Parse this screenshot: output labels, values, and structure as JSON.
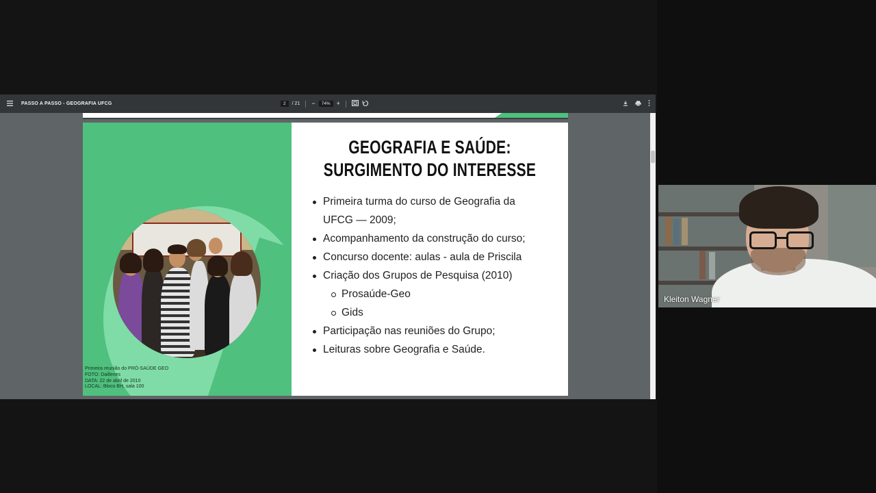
{
  "viewer": {
    "menu_icon": "hamburger-menu-icon",
    "doc_title": "PASSO A PASSO - GEOGRAFIA UFCG",
    "page_current": "2",
    "page_total": "/ 21",
    "zoom": "74%",
    "zoom_out": "−",
    "zoom_in": "+",
    "icons": [
      "fit-page-icon",
      "rotate-icon",
      "download-icon",
      "print-icon",
      "more-vert-icon"
    ]
  },
  "slide": {
    "title_line1": "GEOGRAFIA E SAÚDE:",
    "title_line2": "SURGIMENTO DO INTERESSE",
    "bullets": [
      {
        "text": "Primeira turma do curso de Geografia da",
        "level": 1
      },
      {
        "text": "UFCG — 2009;",
        "level": 0
      },
      {
        "text": "Acompanhamento da construção do curso;",
        "level": 1
      },
      {
        "text": "Concurso docente: aulas - aula de Priscila",
        "level": 1
      },
      {
        "text": "Criação dos Grupos de Pesquisa (2010)",
        "level": 1
      },
      {
        "text": "Prosaúde-Geo",
        "level": 2
      },
      {
        "text": "Gids",
        "level": 2
      },
      {
        "text": "Participação nas reuniões do Grupo;",
        "level": 1
      },
      {
        "text": "Leituras sobre Geografia e Saúde.",
        "level": 1
      }
    ],
    "caption": [
      "Primeira reunião do PRÓ-SAÚDE GEO",
      "FOTO: Daillenes",
      "DATA: 22 de abril de 2010",
      "LOCAL: Bloco BH, sala 100"
    ],
    "accent_color": "#4fc07e"
  },
  "participant": {
    "name": "Kleiton Wagner"
  }
}
